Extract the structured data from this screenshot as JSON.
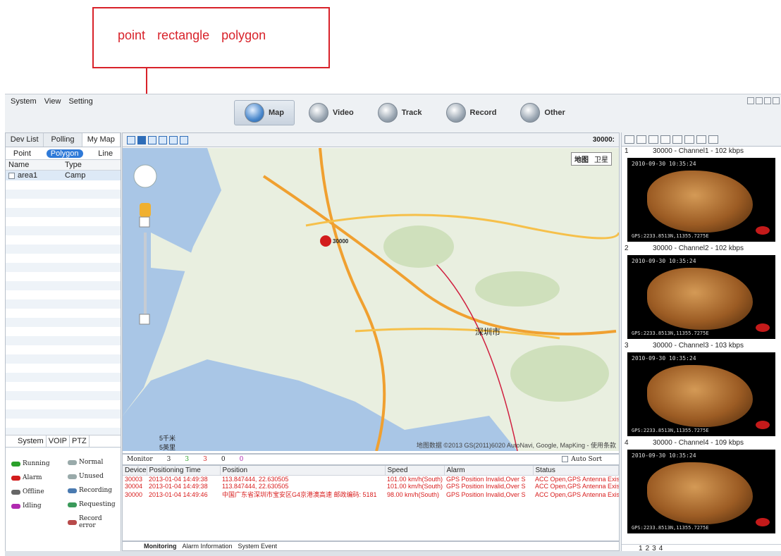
{
  "annotation": {
    "items": [
      "point",
      "rectangle",
      "polygon"
    ]
  },
  "menu": [
    "System",
    "View",
    "Setting"
  ],
  "toolbar": [
    {
      "label": "Map",
      "icon": "map-icon",
      "active": true
    },
    {
      "label": "Video",
      "icon": "video-icon"
    },
    {
      "label": "Track",
      "icon": "track-icon"
    },
    {
      "label": "Record",
      "icon": "record-icon"
    },
    {
      "label": "Other",
      "icon": "other-icon"
    }
  ],
  "left": {
    "tabs": [
      "Dev List",
      "Polling",
      "My Map"
    ],
    "subtabs": [
      "Point",
      "Polygon",
      "Line"
    ],
    "headers": [
      "Name",
      "Type"
    ],
    "rows": [
      {
        "name": "area1",
        "type": "Camp"
      }
    ],
    "bottom_tabs": [
      "System",
      "VOIP",
      "PTZ"
    ],
    "legend": {
      "running": "Running",
      "alarm": "Alarm",
      "offline": "Offline",
      "idling": "Idling",
      "normal": "Normal",
      "unused": "Unused",
      "recording": "Recording",
      "requesting": "Requesting",
      "record_error": "Record error"
    }
  },
  "map": {
    "device_id": "30000:",
    "type_map": "地图",
    "type_sat": "卫星",
    "scale_km": "5千米",
    "scale_mi": "5英里",
    "copyright": "地图数据 ©2013 GS(2011)6020 AutoNavi, Google, MapKing - 使用条款",
    "marker_label": "30000",
    "city_label": "深圳市"
  },
  "monitor": {
    "label": "Monitor",
    "total": "3",
    "green": "3",
    "red": "3",
    "gray": "0",
    "purple": "0",
    "auto_sort": "Auto Sort"
  },
  "events": {
    "headers": [
      "Device",
      "Positioning Time",
      "Position",
      "Speed",
      "Alarm",
      "Status"
    ],
    "rows": [
      [
        "30003",
        "2013-01-04 14:49:38",
        "113.847444, 22.630505",
        "101.00 km/h(South)",
        "GPS Position Invalid,Over S",
        "ACC Open,GPS Antenna Exis"
      ],
      [
        "30004",
        "2013-01-04 14:49:38",
        "113.847444, 22.630505",
        "101.00 km/h(South)",
        "GPS Position Invalid,Over S",
        "ACC Open,GPS Antenna Exis"
      ],
      [
        "30000",
        "2013-01-04 14:49:46",
        "中国广东省深圳市宝安区G4京港澳高速 邮政编码: 5181",
        "98.00 km/h(South)",
        "GPS Position Invalid,Over S",
        "ACC Open,GPS Antenna Exis"
      ]
    ],
    "tabs": [
      "Monitoring",
      "Alarm Information",
      "System Event"
    ]
  },
  "channels": [
    {
      "n": "1",
      "title": "30000 - Channel1 - 102 kbps"
    },
    {
      "n": "2",
      "title": "30000 - Channel2 - 102 kbps"
    },
    {
      "n": "3",
      "title": "30000 - Channel3 - 103 kbps"
    },
    {
      "n": "4",
      "title": "30000 - Channel4 - 109 kbps"
    }
  ],
  "video_osd": {
    "time": "2010-09-30 10:35:24",
    "coords": "GPS:2233.8513N,11355.7275E"
  },
  "right_tabs": [
    "1",
    "2",
    "3",
    "4"
  ]
}
